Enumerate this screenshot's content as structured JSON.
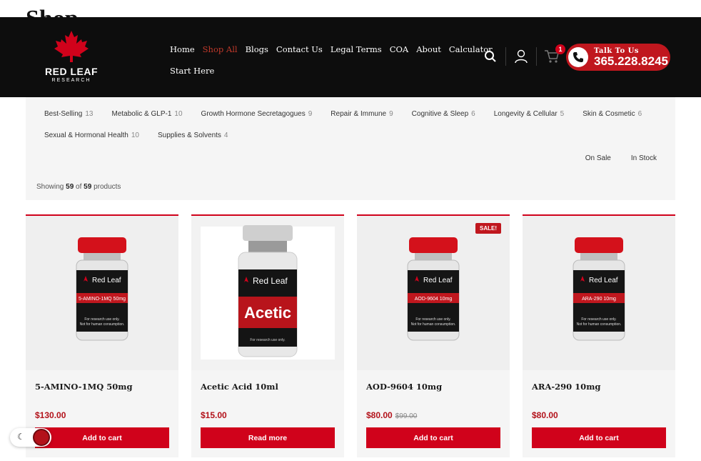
{
  "page": {
    "title": "Shop"
  },
  "header": {
    "logo": {
      "name": "RED LEAF",
      "sub": "RESEARCH"
    },
    "nav_row1": [
      "Home",
      "Shop All",
      "Blogs",
      "Contact Us",
      "Legal Terms",
      "COA",
      "About",
      "Calculator"
    ],
    "nav_row2": [
      "Start Here"
    ],
    "active_nav": "Shop All",
    "cart_count": "1",
    "talk_label": "Talk To Us",
    "phone": "365.228.8245"
  },
  "filters": {
    "categories_row1": [
      {
        "name": "Best-Selling",
        "count": "13"
      },
      {
        "name": "Metabolic & GLP-1",
        "count": "10"
      },
      {
        "name": "Growth Hormone Secretagogues",
        "count": "9"
      },
      {
        "name": "Repair & Immune",
        "count": "9"
      },
      {
        "name": "Cognitive & Sleep",
        "count": "6"
      },
      {
        "name": "Longevity & Cellular",
        "count": "5"
      },
      {
        "name": "Skin & Cosmetic",
        "count": "6"
      }
    ],
    "categories_row2": [
      {
        "name": "Sexual & Hormonal Health",
        "count": "10"
      },
      {
        "name": "Supplies & Solvents",
        "count": "4"
      }
    ],
    "on_sale": "On Sale",
    "in_stock": "In Stock",
    "showing_prefix": "Showing",
    "showing_count": "59",
    "showing_of": "of",
    "showing_total": "59",
    "showing_suffix": "products"
  },
  "products": [
    {
      "name": "5-AMINO-1MQ 50mg",
      "price": "$130.00",
      "old_price": "",
      "button": "Add to cart",
      "sale": "",
      "vial_label": "5-AMINO-1MQ 50mg"
    },
    {
      "name": "Acetic Acid 10ml",
      "price": "$15.00",
      "old_price": "",
      "button": "Read more",
      "sale": "",
      "vial_label": "Acetic"
    },
    {
      "name": "AOD-9604 10mg",
      "price": "$80.00",
      "old_price": "$99.00",
      "button": "Add to cart",
      "sale": "SALE!",
      "vial_label": "AOD-9604 10mg"
    },
    {
      "name": "ARA-290 10mg",
      "price": "$80.00",
      "old_price": "",
      "button": "Add to cart",
      "sale": "",
      "vial_label": "ARA-290 10mg"
    }
  ],
  "vial": {
    "brand": "Red Leaf",
    "note1": "For research use only.",
    "note2": "Not for human consumption."
  },
  "colors": {
    "brand_red": "#d0021b",
    "header_bg": "#0d0d0d",
    "panel_bg": "#f5f5f5"
  }
}
